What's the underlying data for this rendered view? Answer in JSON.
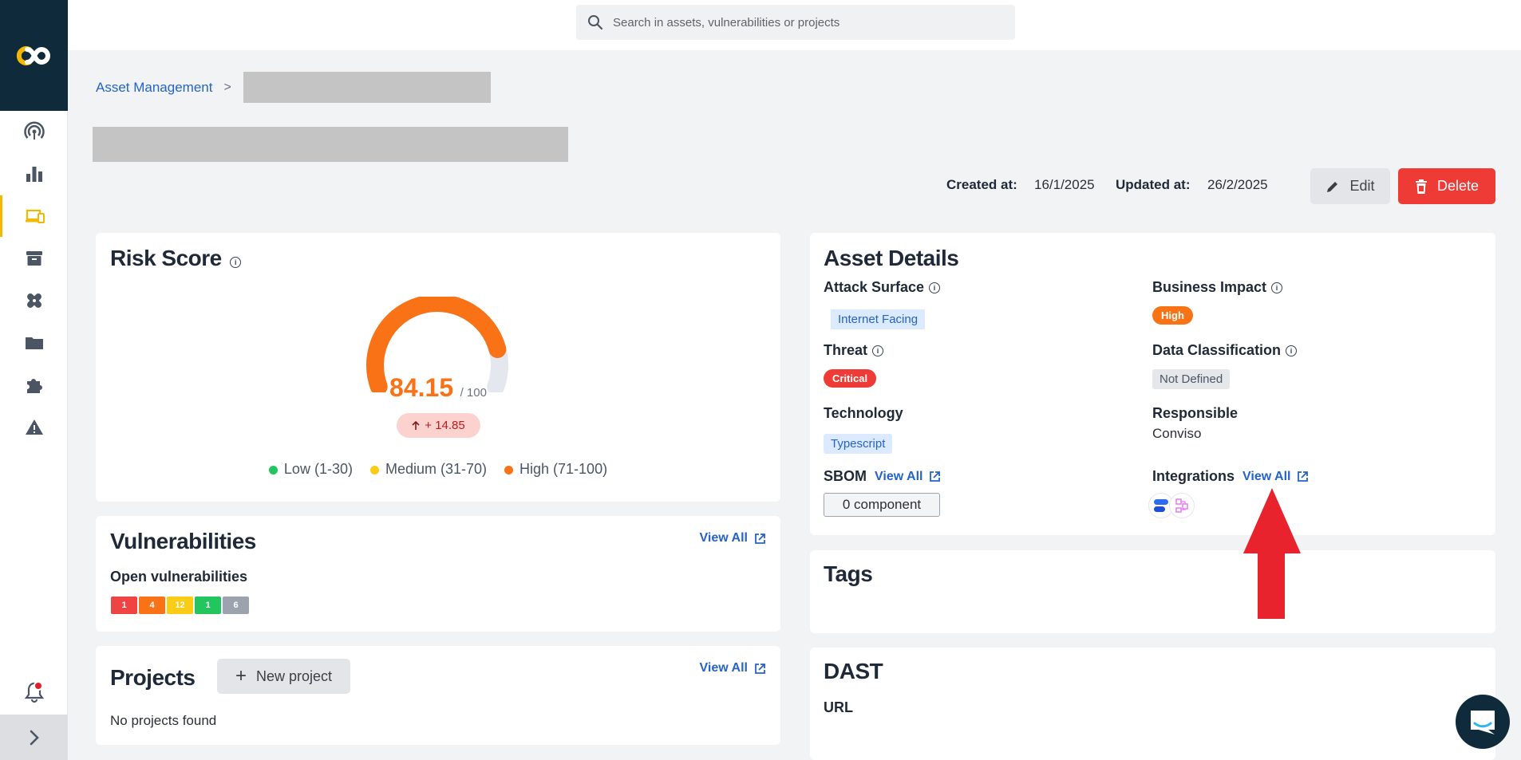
{
  "search": {
    "placeholder": "Search in assets, vulnerabilities or projects"
  },
  "breadcrumb": {
    "root": "Asset Management",
    "separator": ">"
  },
  "meta": {
    "created_label": "Created at:",
    "created_value": "16/1/2025",
    "updated_label": "Updated at:",
    "updated_value": "26/2/2025"
  },
  "actions": {
    "edit_label": "Edit",
    "delete_label": "Delete"
  },
  "risk": {
    "title": "Risk Score",
    "score": "84.15",
    "max": "/ 100",
    "score_fraction": 0.8415,
    "delta": "+ 14.85",
    "legend": [
      {
        "label": "Low (1-30)",
        "color": "#22c55e"
      },
      {
        "label": "Medium (31-70)",
        "color": "#facc15"
      },
      {
        "label": "High (71-100)",
        "color": "#f97316"
      }
    ]
  },
  "vulnerabilities": {
    "title": "Vulnerabilities",
    "view_all": "View All",
    "open_label": "Open vulnerabilities",
    "counts": [
      {
        "value": "1",
        "color": "#ef4444"
      },
      {
        "value": "4",
        "color": "#f97316"
      },
      {
        "value": "12",
        "color": "#facc15"
      },
      {
        "value": "1",
        "color": "#22c55e"
      },
      {
        "value": "6",
        "color": "#9ca3af"
      }
    ]
  },
  "projects": {
    "title": "Projects",
    "new_project": "New project",
    "view_all": "View All",
    "empty": "No projects found"
  },
  "asset_details": {
    "title": "Asset Details",
    "attack_surface_label": "Attack Surface",
    "attack_surface_value": "Internet Facing",
    "business_impact_label": "Business Impact",
    "business_impact_value": "High",
    "threat_label": "Threat",
    "threat_value": "Critical",
    "data_classification_label": "Data Classification",
    "data_classification_value": "Not Defined",
    "technology_label": "Technology",
    "technology_value": "Typescript",
    "responsible_label": "Responsible",
    "responsible_value": "Conviso",
    "sbom_label": "SBOM",
    "sbom_view_all": "View All",
    "sbom_components": "0 component",
    "integrations_label": "Integrations",
    "integrations_view_all": "View All"
  },
  "tags": {
    "title": "Tags"
  },
  "dast": {
    "title": "DAST",
    "url_label": "URL"
  },
  "colors": {
    "accent": "#2563c9",
    "brand_dark": "#0f2a3a",
    "brand_yellow": "#f5b800",
    "delete": "#ee3b36",
    "risk_orange": "#f97316"
  }
}
